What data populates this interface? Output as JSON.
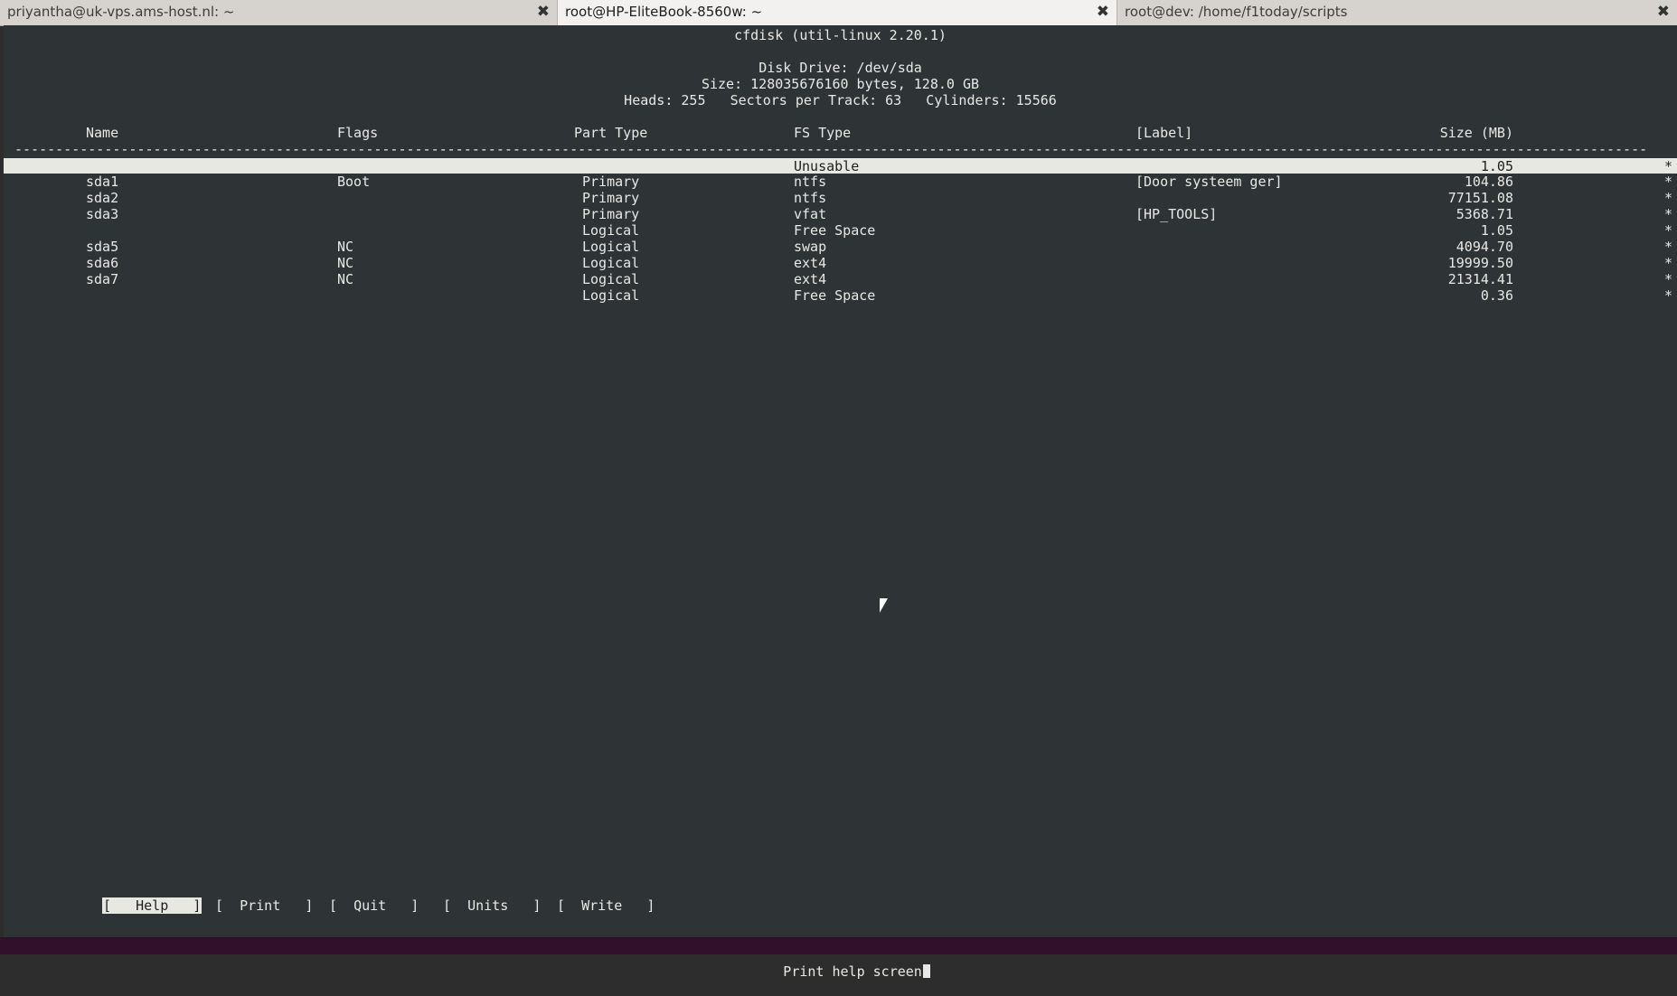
{
  "tabs": [
    {
      "title": "priyantha@uk-vps.ams-host.nl: ~",
      "close": "✖"
    },
    {
      "title": "root@HP-EliteBook-8560w: ~",
      "close": "✖"
    },
    {
      "title": "root@dev: /home/f1today/scripts",
      "close": "✖"
    }
  ],
  "header": {
    "app": "cfdisk (util-linux 2.20.1)",
    "disk": "Disk Drive: /dev/sda",
    "size": "Size: 128035676160 bytes, 128.0 GB",
    "geometry": "Heads: 255   Sectors per Track: 63   Cylinders: 15566"
  },
  "table": {
    "columns": {
      "name": "Name",
      "flags": "Flags",
      "part_type": "Part Type",
      "fs_type": "FS Type",
      "label": "[Label]",
      "size": "Size (MB)"
    },
    "rows": [
      {
        "name": "",
        "flags": "",
        "part_type": "",
        "fs_type": "Unusable",
        "label": "",
        "size": "1.05",
        "star": "*"
      },
      {
        "name": "sda1",
        "flags": "Boot",
        "part_type": "Primary",
        "fs_type": "ntfs",
        "label": "[Door systeem ger]",
        "size": "104.86",
        "star": "*"
      },
      {
        "name": "sda2",
        "flags": "",
        "part_type": "Primary",
        "fs_type": "ntfs",
        "label": "",
        "size": "77151.08",
        "star": "*"
      },
      {
        "name": "sda3",
        "flags": "",
        "part_type": "Primary",
        "fs_type": "vfat",
        "label": "[HP_TOOLS]",
        "size": "5368.71",
        "star": "*"
      },
      {
        "name": "",
        "flags": "",
        "part_type": "Logical",
        "fs_type": "Free Space",
        "label": "",
        "size": "1.05",
        "star": "*"
      },
      {
        "name": "sda5",
        "flags": "NC",
        "part_type": "Logical",
        "fs_type": "swap",
        "label": "",
        "size": "4094.70",
        "star": "*"
      },
      {
        "name": "sda6",
        "flags": "NC",
        "part_type": "Logical",
        "fs_type": "ext4",
        "label": "",
        "size": "19999.50",
        "star": "*"
      },
      {
        "name": "sda7",
        "flags": "NC",
        "part_type": "Logical",
        "fs_type": "ext4",
        "label": "",
        "size": "21314.41",
        "star": "*"
      },
      {
        "name": "",
        "flags": "",
        "part_type": "Logical",
        "fs_type": "Free Space",
        "label": "",
        "size": "0.36",
        "star": "*"
      }
    ]
  },
  "menu": {
    "help": "[   Help   ]",
    "print": "[  Print   ]",
    "quit": "[  Quit   ]",
    "units": "[  Units   ]",
    "write": "[  Write   ]"
  },
  "status": "Print help screen"
}
